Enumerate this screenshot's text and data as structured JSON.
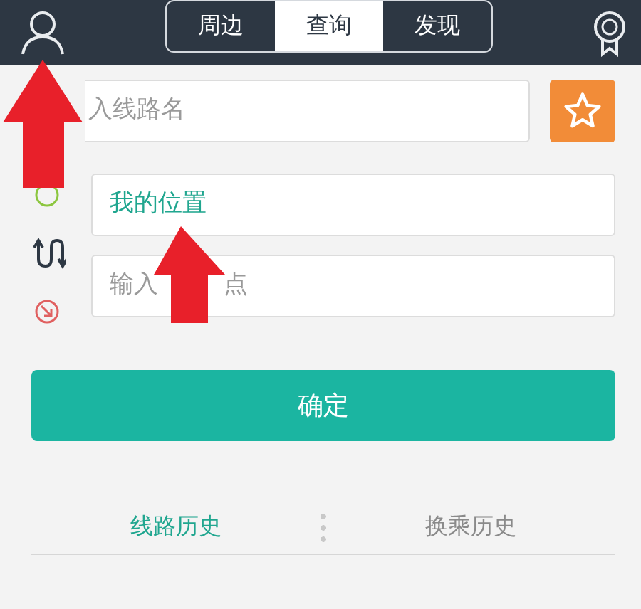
{
  "header": {
    "tabs": [
      {
        "label": "周边",
        "selected": false
      },
      {
        "label": "查询",
        "selected": true
      },
      {
        "label": "发现",
        "selected": false
      }
    ]
  },
  "route_search": {
    "placeholder": "入线路名"
  },
  "start_field": {
    "value": "我的位置"
  },
  "end_field": {
    "visible_text": [
      "输入",
      "点"
    ]
  },
  "confirm_button": "确定",
  "history_tabs": [
    {
      "label": "线路历史",
      "selected": true
    },
    {
      "label": "换乘历史",
      "selected": false
    }
  ]
}
